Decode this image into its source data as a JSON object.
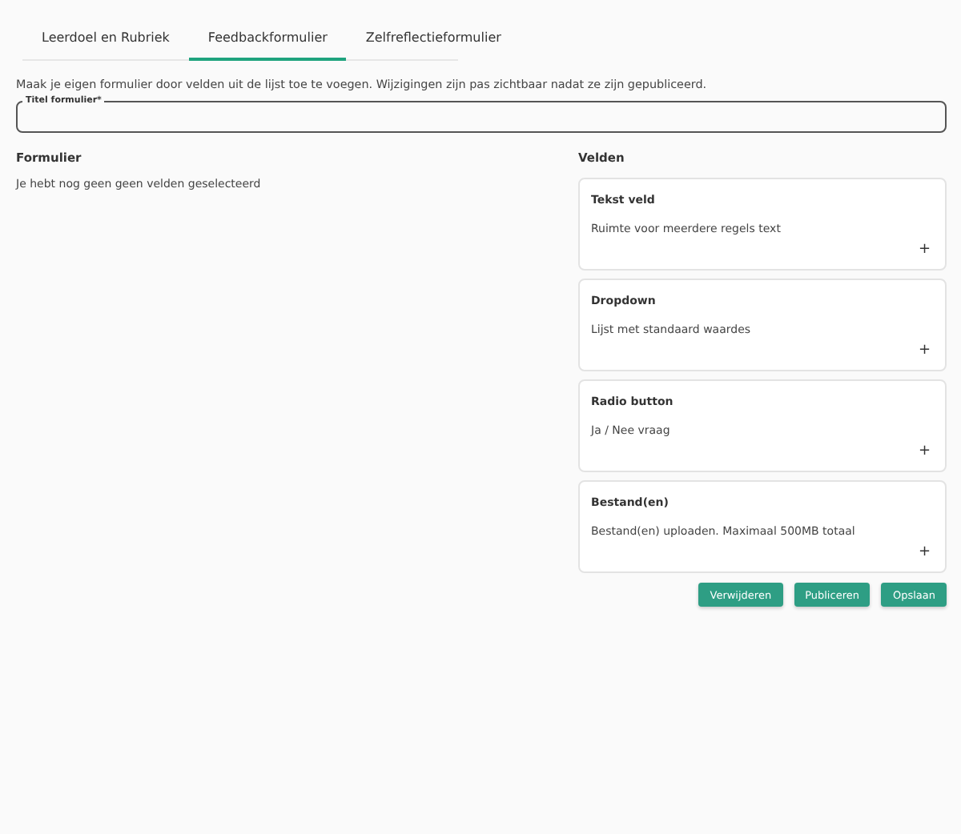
{
  "tabs": [
    {
      "label": "Leerdoel en Rubriek",
      "selected": false
    },
    {
      "label": "Feedbackformulier",
      "selected": true
    },
    {
      "label": "Zelfreflectieformulier",
      "selected": false
    }
  ],
  "intro": "Maak je eigen formulier door velden uit de lijst toe te voegen. Wijzigingen zijn pas zichtbaar nadat ze zijn gepubliceerd.",
  "title_field": {
    "label": "Titel formulier*"
  },
  "form": {
    "heading": "Formulier",
    "empty_text": "Je hebt nog geen geen velden geselecteerd"
  },
  "fields": {
    "heading": "Velden",
    "items": [
      {
        "title": "Tekst veld",
        "description": "Ruimte voor meerdere regels text",
        "add": "+"
      },
      {
        "title": "Dropdown",
        "description": "Lijst met standaard waardes",
        "add": "+"
      },
      {
        "title": "Radio button",
        "description": "Ja / Nee vraag",
        "add": "+"
      },
      {
        "title": "Bestand(en)",
        "description": "Bestand(en) uploaden. Maximaal 500MB totaal",
        "add": "+"
      }
    ]
  },
  "buttons": [
    "Verwijderen",
    "Publiceren",
    "Opslaan"
  ]
}
